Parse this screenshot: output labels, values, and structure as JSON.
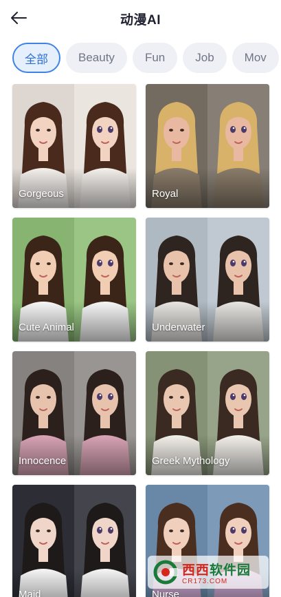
{
  "header": {
    "title": "动漫AI",
    "back_icon": "arrow-left-icon"
  },
  "tabs": [
    {
      "label": "全部",
      "active": true
    },
    {
      "label": "Beauty",
      "active": false
    },
    {
      "label": "Fun",
      "active": false
    },
    {
      "label": "Job",
      "active": false
    },
    {
      "label": "Mov",
      "active": false
    }
  ],
  "cards": [
    {
      "label": "Gorgeous",
      "bg": "#e9e2dd",
      "skin": "#f2d2c0",
      "hair": "#4a2a1c",
      "cloth": "#f4f0ec"
    },
    {
      "label": "Royal",
      "bg": "#7a7166",
      "skin": "#e8b9a0",
      "hair": "#d9b26a",
      "cloth": "#8a7c6a"
    },
    {
      "label": "Cute Animal",
      "bg": "#8fbf78",
      "skin": "#f1cdb4",
      "hair": "#3a2518",
      "cloth": "#f7f7f7"
    },
    {
      "label": "Underwater",
      "bg": "#b9c3cc",
      "skin": "#e9c2ac",
      "hair": "#2e2420",
      "cloth": "#e8e6e2"
    },
    {
      "label": "Innocence",
      "bg": "#8e8a86",
      "skin": "#e7c3ae",
      "hair": "#2b201c",
      "cloth": "#d9a4b6"
    },
    {
      "label": "Greek Mythology",
      "bg": "#8d9a7c",
      "skin": "#e9c6b0",
      "hair": "#3a2a22",
      "cloth": "#f3f0ea"
    },
    {
      "label": "Maid",
      "bg": "#2f3038",
      "skin": "#efd6c8",
      "hair": "#1e1a1a",
      "cloth": "#f6f6f6"
    },
    {
      "label": "Nurse",
      "bg": "#6f8fb0",
      "skin": "#f0cfbd",
      "hair": "#4a2e20",
      "cloth": "#c9a7cf"
    }
  ],
  "watermark": {
    "main_red": "西西",
    "main_green": "软件园",
    "sub": "CR173.COM"
  },
  "colors": {
    "accent": "#3e82e6",
    "tab_inactive_bg": "#eef0f5"
  }
}
